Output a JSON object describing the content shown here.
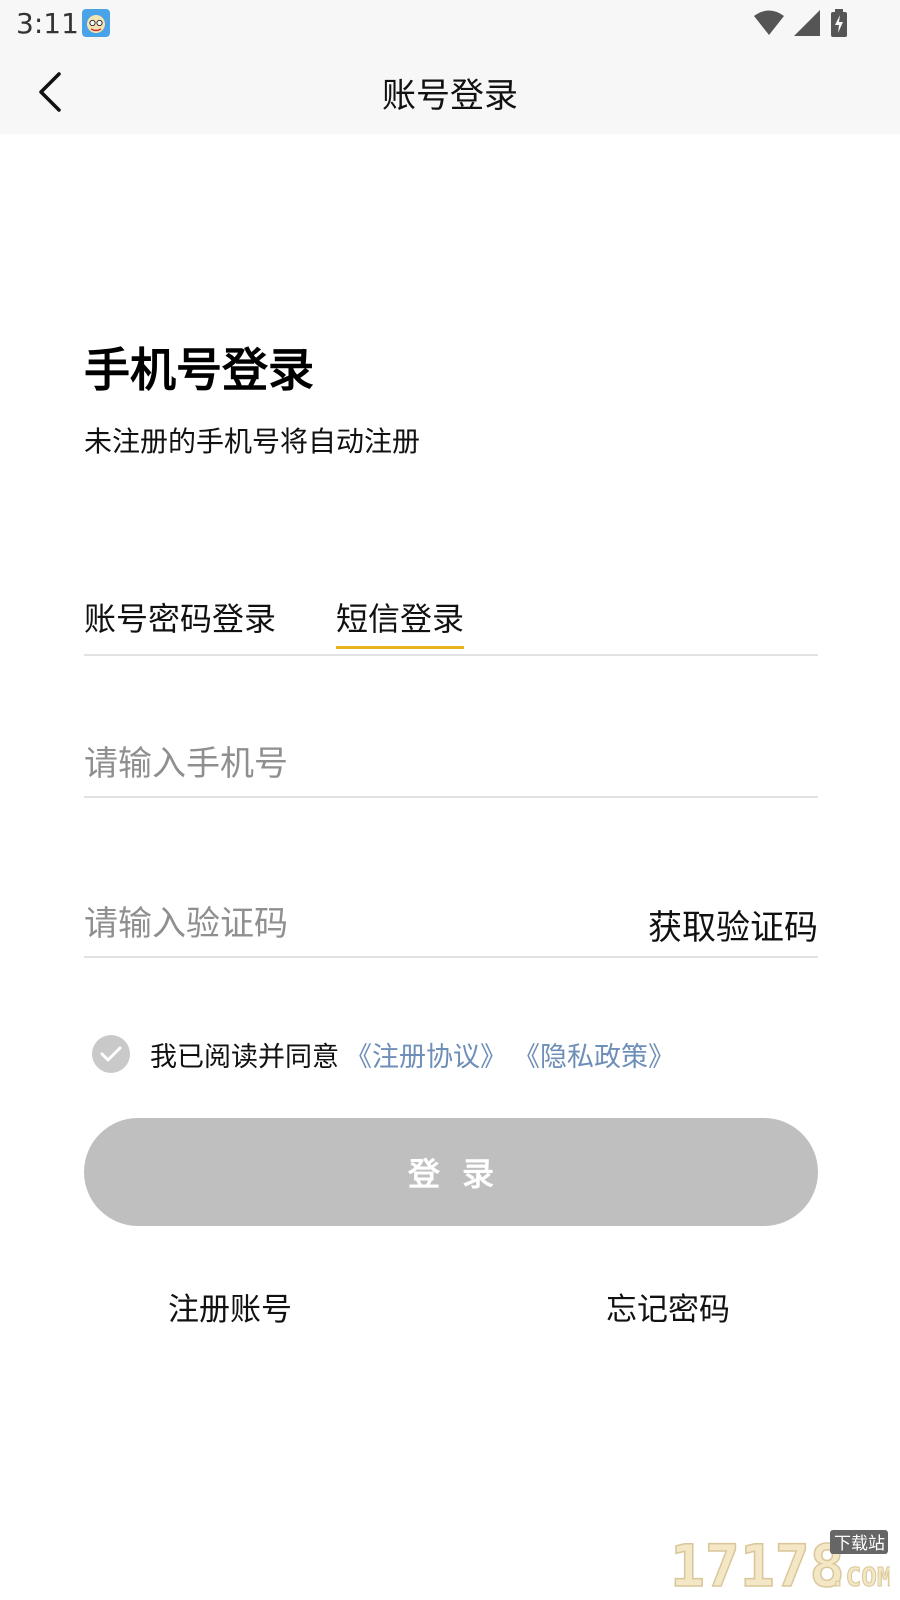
{
  "status_bar": {
    "time": "3:11",
    "icons": [
      "app-avatar-icon",
      "wifi-icon",
      "signal-icon",
      "battery-charging-icon"
    ]
  },
  "header": {
    "back_icon": "chevron-left-icon",
    "title": "账号登录"
  },
  "login": {
    "heading": "手机号登录",
    "subtitle": "未注册的手机号将自动注册",
    "tabs": [
      {
        "label": "账号密码登录",
        "active": false
      },
      {
        "label": "短信登录",
        "active": true
      }
    ],
    "phone_placeholder": "请输入手机号",
    "code_placeholder": "请输入验证码",
    "get_code_label": "获取验证码",
    "agreement": {
      "checked": true,
      "text": "我已阅读并同意",
      "terms_link": "《注册协议》",
      "privacy_link": "《隐私政策》"
    },
    "login_button_label": "登录",
    "register_link": "注册账号",
    "forgot_link": "忘记密码"
  },
  "watermark": {
    "text": "17178",
    "badge": "下载站",
    "suffix": ".COM"
  },
  "colors": {
    "accent_underline": "#e8b21c",
    "link": "#6f8fb8",
    "button_disabled": "#bfbfbf",
    "bar_background": "#f7f7f7"
  }
}
